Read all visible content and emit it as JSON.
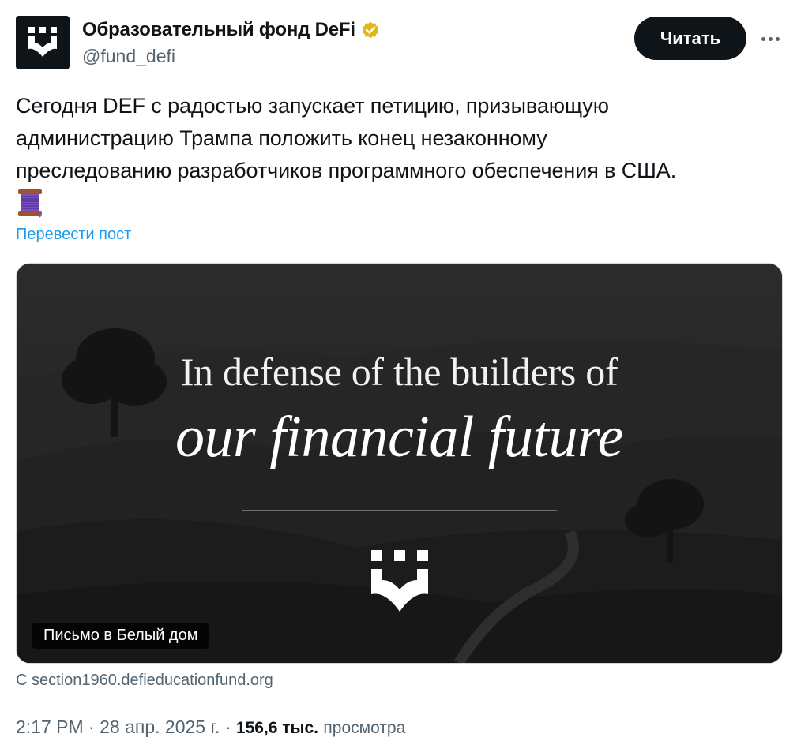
{
  "account": {
    "display_name": "Образовательный фонд DeFi",
    "handle": "@fund_defi",
    "verified_icon": "verified-badge-gold"
  },
  "actions": {
    "read_label": "Читать",
    "more_icon": "more-dots-icon"
  },
  "post": {
    "text_lines": [
      "Сегодня DEF с радостью запускает петицию, призывающую",
      "администрацию Трампа положить конец незаконному",
      "преследованию разработчиков программного обеспечения в США."
    ],
    "emoji": "spool-of-thread",
    "translate_label": "Перевести пост"
  },
  "media": {
    "headline_1": "In defense of the builders of",
    "headline_2": "our financial future",
    "caption": "Письмо в Белый дом",
    "source": "С section1960.defieducationfund.org"
  },
  "meta": {
    "time": "2:17 PM",
    "separator": "·",
    "date": "28 апр. 2025 г.",
    "views_count": "156,6 тыс.",
    "views_label": "просмотра"
  },
  "colors": {
    "text": "#0f1419",
    "muted": "#536471",
    "link": "#1d9bf0",
    "verified": "#e2b719"
  }
}
